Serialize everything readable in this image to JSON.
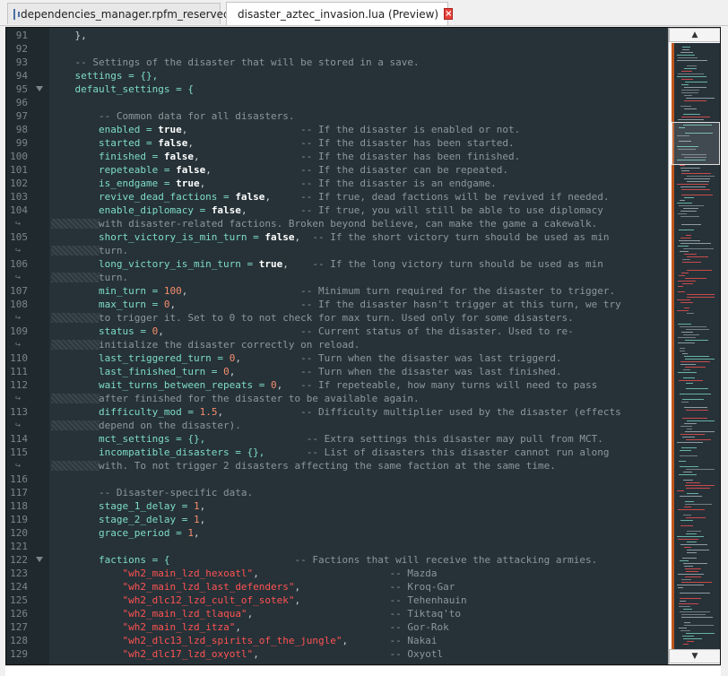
{
  "tabs": [
    {
      "label": "dependencies_manager.rpfm_reserved",
      "icon": "document-info-icon",
      "active": false
    },
    {
      "label": "disaster_aztec_invasion.lua (Preview)",
      "icon": "lua-file-icon",
      "active": true
    }
  ],
  "scroll": {
    "up": "▲",
    "down": "▼"
  },
  "wrap_glyph": "↪",
  "colors": {
    "background": "#263238",
    "comment": "#8c979c",
    "identifier": "#7fdbca",
    "keyword": "#ffffff",
    "number": "#f78c6c",
    "string": "#ff5252"
  },
  "lines": [
    {
      "n": "91",
      "segs": [
        [
          "    },",
          "p"
        ]
      ]
    },
    {
      "n": "92",
      "segs": []
    },
    {
      "n": "93",
      "segs": [
        [
          "    -- Settings of the disaster that will be stored in a save.",
          "c"
        ]
      ]
    },
    {
      "n": "94",
      "segs": [
        [
          "    settings = {},",
          "v"
        ]
      ]
    },
    {
      "n": "95",
      "fold": true,
      "segs": [
        [
          "    default_settings = {",
          "v"
        ]
      ]
    },
    {
      "n": "96",
      "segs": []
    },
    {
      "n": "97",
      "segs": [
        [
          "        -- Common data for all disasters.",
          "c"
        ]
      ]
    },
    {
      "n": "98",
      "segs": [
        [
          "        enabled = ",
          "v"
        ],
        [
          "true",
          "k"
        ],
        [
          ",",
          "p"
        ],
        [
          "                   -- If the disaster is enabled or not.",
          "c"
        ]
      ]
    },
    {
      "n": "99",
      "segs": [
        [
          "        started = ",
          "v"
        ],
        [
          "false",
          "k"
        ],
        [
          ",",
          "p"
        ],
        [
          "                  -- If the disaster has been started.",
          "c"
        ]
      ]
    },
    {
      "n": "100",
      "segs": [
        [
          "        finished = ",
          "v"
        ],
        [
          "false",
          "k"
        ],
        [
          ",",
          "p"
        ],
        [
          "                 -- If the disaster has been finished.",
          "c"
        ]
      ]
    },
    {
      "n": "101",
      "segs": [
        [
          "        repeteable = ",
          "v"
        ],
        [
          "false",
          "k"
        ],
        [
          ",",
          "p"
        ],
        [
          "               -- If the disaster can be repeated.",
          "c"
        ]
      ]
    },
    {
      "n": "102",
      "segs": [
        [
          "        is_endgame = ",
          "v"
        ],
        [
          "true",
          "k"
        ],
        [
          ",",
          "p"
        ],
        [
          "                -- If the disaster is an endgame.",
          "c"
        ]
      ]
    },
    {
      "n": "103",
      "segs": [
        [
          "        revive_dead_factions = ",
          "v"
        ],
        [
          "false",
          "k"
        ],
        [
          ",",
          "p"
        ],
        [
          "     -- If true, dead factions will be revived if needed.",
          "c"
        ]
      ]
    },
    {
      "n": "104",
      "segs": [
        [
          "        enable_diplomacy = ",
          "v"
        ],
        [
          "false",
          "k"
        ],
        [
          ",",
          "p"
        ],
        [
          "         -- If true, you will still be able to use diplomacy",
          "c"
        ]
      ]
    },
    {
      "n": "",
      "wrap": true,
      "segs": [
        [
          "        with disaster-related factions. Broken beyond believe, can make the game a cakewalk.",
          "c"
        ]
      ]
    },
    {
      "n": "105",
      "segs": [
        [
          "        short_victory_is_min_turn = ",
          "v"
        ],
        [
          "false",
          "k"
        ],
        [
          ",",
          "p"
        ],
        [
          "  -- If the short victory turn should be used as min",
          "c"
        ]
      ]
    },
    {
      "n": "",
      "wrap": true,
      "segs": [
        [
          "        turn.",
          "c"
        ]
      ]
    },
    {
      "n": "106",
      "segs": [
        [
          "        long_victory_is_min_turn = ",
          "v"
        ],
        [
          "true",
          "k"
        ],
        [
          ",",
          "p"
        ],
        [
          "    -- If the long victory turn should be used as min",
          "c"
        ]
      ]
    },
    {
      "n": "",
      "wrap": true,
      "segs": [
        [
          "        turn.",
          "c"
        ]
      ]
    },
    {
      "n": "107",
      "segs": [
        [
          "        min_turn = ",
          "v"
        ],
        [
          "100",
          "n"
        ],
        [
          ",",
          "p"
        ],
        [
          "                   -- Minimum turn required for the disaster to trigger.",
          "c"
        ]
      ]
    },
    {
      "n": "108",
      "segs": [
        [
          "        max_turn = ",
          "v"
        ],
        [
          "0",
          "n"
        ],
        [
          ",",
          "p"
        ],
        [
          "                     -- If the disaster hasn't trigger at this turn, we try",
          "c"
        ]
      ]
    },
    {
      "n": "",
      "wrap": true,
      "segs": [
        [
          "        to trigger it. Set to 0 to not check for max turn. Used only for some disasters.",
          "c"
        ]
      ]
    },
    {
      "n": "109",
      "segs": [
        [
          "        status = ",
          "v"
        ],
        [
          "0",
          "n"
        ],
        [
          ",",
          "p"
        ],
        [
          "                       -- Current status of the disaster. Used to re-",
          "c"
        ]
      ]
    },
    {
      "n": "",
      "wrap": true,
      "segs": [
        [
          "        initialize the disaster correctly on reload.",
          "c"
        ]
      ]
    },
    {
      "n": "110",
      "segs": [
        [
          "        last_triggered_turn = ",
          "v"
        ],
        [
          "0",
          "n"
        ],
        [
          ",",
          "p"
        ],
        [
          "          -- Turn when the disaster was last triggerd.",
          "c"
        ]
      ]
    },
    {
      "n": "111",
      "segs": [
        [
          "        last_finished_turn = ",
          "v"
        ],
        [
          "0",
          "n"
        ],
        [
          ",",
          "p"
        ],
        [
          "           -- Turn when the disaster was last finished.",
          "c"
        ]
      ]
    },
    {
      "n": "112",
      "segs": [
        [
          "        wait_turns_between_repeats = ",
          "v"
        ],
        [
          "0",
          "n"
        ],
        [
          ",",
          "p"
        ],
        [
          "   -- If repeteable, how many turns will need to pass",
          "c"
        ]
      ]
    },
    {
      "n": "",
      "wrap": true,
      "segs": [
        [
          "        after finished for the disaster to be available again.",
          "c"
        ]
      ]
    },
    {
      "n": "113",
      "segs": [
        [
          "        difficulty_mod = ",
          "v"
        ],
        [
          "1.5",
          "n"
        ],
        [
          ",",
          "p"
        ],
        [
          "             -- Difficulty multiplier used by the disaster (effects",
          "c"
        ]
      ]
    },
    {
      "n": "",
      "wrap": true,
      "segs": [
        [
          "        depend on the disaster).",
          "c"
        ]
      ]
    },
    {
      "n": "114",
      "segs": [
        [
          "        mct_settings = {},",
          "v"
        ],
        [
          "                 -- Extra settings this disaster may pull from MCT.",
          "c"
        ]
      ]
    },
    {
      "n": "115",
      "segs": [
        [
          "        incompatible_disasters = {},",
          "v"
        ],
        [
          "       -- List of disasters this disaster cannot run along",
          "c"
        ]
      ]
    },
    {
      "n": "",
      "wrap": true,
      "segs": [
        [
          "        with. To not trigger 2 disasters affecting the same faction at the same time.",
          "c"
        ]
      ]
    },
    {
      "n": "116",
      "segs": []
    },
    {
      "n": "117",
      "segs": [
        [
          "        -- Disaster-specific data.",
          "c"
        ]
      ]
    },
    {
      "n": "118",
      "segs": [
        [
          "        stage_1_delay = ",
          "v"
        ],
        [
          "1",
          "n"
        ],
        [
          ",",
          "p"
        ]
      ]
    },
    {
      "n": "119",
      "segs": [
        [
          "        stage_2_delay = ",
          "v"
        ],
        [
          "1",
          "n"
        ],
        [
          ",",
          "p"
        ]
      ]
    },
    {
      "n": "120",
      "segs": [
        [
          "        grace_period = ",
          "v"
        ],
        [
          "1",
          "n"
        ],
        [
          ",",
          "p"
        ]
      ]
    },
    {
      "n": "121",
      "segs": []
    },
    {
      "n": "122",
      "fold": true,
      "segs": [
        [
          "        factions = {",
          "v"
        ],
        [
          "                     -- Factions that will receive the attacking armies.",
          "c"
        ]
      ]
    },
    {
      "n": "123",
      "segs": [
        [
          "            ",
          "p"
        ],
        [
          "\"wh2_main_lzd_hexoatl\"",
          "s"
        ],
        [
          ",",
          "p"
        ],
        [
          "                      -- Mazda",
          "c"
        ]
      ]
    },
    {
      "n": "124",
      "segs": [
        [
          "            ",
          "p"
        ],
        [
          "\"wh2_main_lzd_last_defenders\"",
          "s"
        ],
        [
          ",",
          "p"
        ],
        [
          "               -- Kroq-Gar",
          "c"
        ]
      ]
    },
    {
      "n": "125",
      "segs": [
        [
          "            ",
          "p"
        ],
        [
          "\"wh2_dlc12_lzd_cult_of_sotek\"",
          "s"
        ],
        [
          ",",
          "p"
        ],
        [
          "               -- Tehenhauin",
          "c"
        ]
      ]
    },
    {
      "n": "126",
      "segs": [
        [
          "            ",
          "p"
        ],
        [
          "\"wh2_main_lzd_tlaqua\"",
          "s"
        ],
        [
          ",",
          "p"
        ],
        [
          "                       -- Tiktaq'to",
          "c"
        ]
      ]
    },
    {
      "n": "127",
      "segs": [
        [
          "            ",
          "p"
        ],
        [
          "\"wh2_main_lzd_itza\"",
          "s"
        ],
        [
          ",",
          "p"
        ],
        [
          "                         -- Gor-Rok",
          "c"
        ]
      ]
    },
    {
      "n": "128",
      "segs": [
        [
          "            ",
          "p"
        ],
        [
          "\"wh2_dlc13_lzd_spirits_of_the_jungle\"",
          "s"
        ],
        [
          ",",
          "p"
        ],
        [
          "       -- Nakai",
          "c"
        ]
      ]
    },
    {
      "n": "129",
      "segs": [
        [
          "            ",
          "p"
        ],
        [
          "\"wh2_dlc17_lzd_oxyotl\"",
          "s"
        ],
        [
          ",",
          "p"
        ],
        [
          "                      -- Oxyotl",
          "c"
        ]
      ]
    }
  ]
}
